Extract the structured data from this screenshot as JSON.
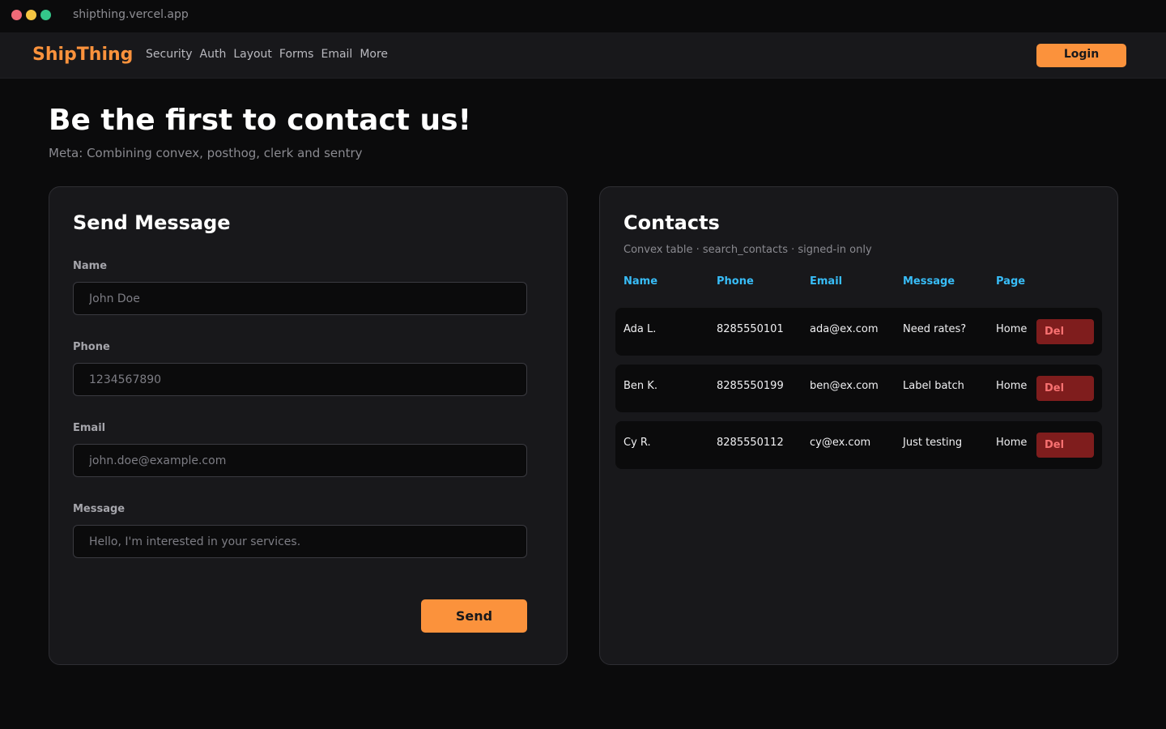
{
  "browser": {
    "url": "shipthing.vercel.app"
  },
  "navbar": {
    "brand": "ShipThing",
    "links": [
      "Security",
      "Auth",
      "Layout",
      "Forms",
      "Email",
      "More"
    ],
    "login_label": "Login"
  },
  "header": {
    "title": "Be the first to contact us!",
    "subtitle": "Meta: Combining convex, posthog, clerk and sentry"
  },
  "form": {
    "title": "Send Message",
    "fields": [
      {
        "label": "Name",
        "placeholder": "John Doe",
        "value": ""
      },
      {
        "label": "Phone",
        "placeholder": "1234567890",
        "value": ""
      },
      {
        "label": "Email",
        "placeholder": "john.doe@example.com",
        "value": ""
      },
      {
        "label": "Message",
        "placeholder": "Hello, I'm interested in your services.",
        "value": ""
      }
    ],
    "submit_label": "Send"
  },
  "contacts": {
    "title": "Contacts",
    "subtitle": "Convex table · search_contacts · signed-in only",
    "columns": [
      "Name",
      "Phone",
      "Email",
      "Message",
      "Page"
    ],
    "delete_label": "Del",
    "rows": [
      {
        "name": "Ada L.",
        "phone": "8285550101",
        "email": "ada@ex.com",
        "message": "Need rates?",
        "page": "Home"
      },
      {
        "name": "Ben K.",
        "phone": "8285550199",
        "email": "ben@ex.com",
        "message": "Label batch",
        "page": "Home"
      },
      {
        "name": "Cy R.",
        "phone": "8285550112",
        "email": "cy@ex.com",
        "message": "Just testing",
        "page": "Home"
      }
    ]
  },
  "colors": {
    "accent": "#fb923c",
    "link": "#38bdf8",
    "danger_bg": "#7f1d1d",
    "danger_text": "#f87171",
    "background": "#0b0b0c",
    "surface": "#18181b"
  }
}
